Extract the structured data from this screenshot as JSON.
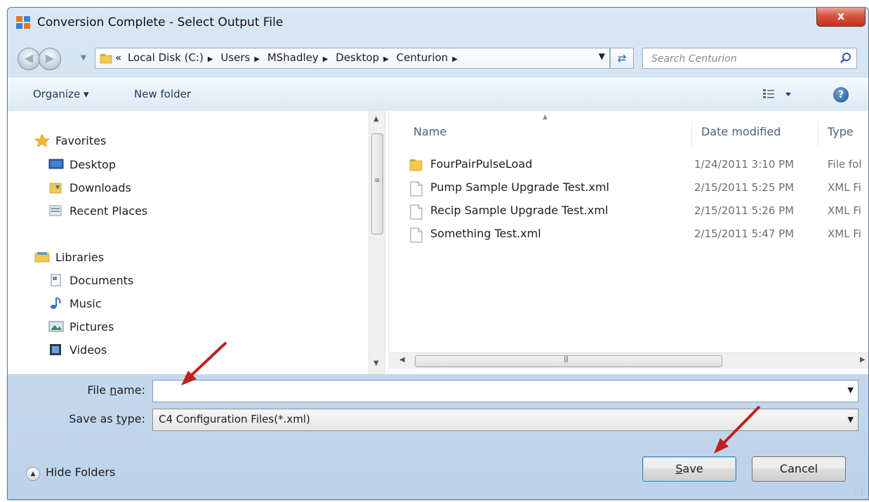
{
  "window": {
    "title": "Conversion Complete - Select Output File",
    "close_label": "x"
  },
  "address": {
    "overflow": "«",
    "path": [
      "Local Disk (C:)",
      "Users",
      "MShadley",
      "Desktop",
      "Centurion"
    ],
    "search_placeholder": "Search Centurion"
  },
  "toolbar": {
    "organize_label": "Organize ▾",
    "new_folder_label": "New folder",
    "help_label": "?"
  },
  "nav": {
    "favorites": {
      "label": "Favorites",
      "items": [
        "Desktop",
        "Downloads",
        "Recent Places"
      ]
    },
    "libraries": {
      "label": "Libraries",
      "items": [
        "Documents",
        "Music",
        "Pictures",
        "Videos"
      ]
    }
  },
  "files": {
    "columns": {
      "name": "Name",
      "date": "Date modified",
      "type": "Type"
    },
    "rows": [
      {
        "name": "FourPairPulseLoad",
        "date": "1/24/2011 3:10 PM",
        "type": "File fol",
        "icon": "folder-icon"
      },
      {
        "name": "Pump Sample Upgrade Test.xml",
        "date": "2/15/2011 5:25 PM",
        "type": "XML Fi",
        "icon": "file-icon"
      },
      {
        "name": "Recip Sample Upgrade Test.xml",
        "date": "2/15/2011 5:26 PM",
        "type": "XML Fi",
        "icon": "file-icon"
      },
      {
        "name": "Something Test.xml",
        "date": "2/15/2011 5:47 PM",
        "type": "XML Fi",
        "icon": "file-icon"
      }
    ]
  },
  "form": {
    "filename_label_pre": "File ",
    "filename_label_ul": "n",
    "filename_label_post": "ame:",
    "filename_value": "",
    "savetype_label_pre": "Save as ",
    "savetype_label_ul": "t",
    "savetype_label_post": "ype:",
    "savetype_value": "C4 Configuration Files(*.xml)"
  },
  "footer": {
    "hide_folders_label": "Hide Folders",
    "save_ul": "S",
    "save_rest": "ave",
    "cancel_label": "Cancel"
  },
  "colors": {
    "annotation_arrow": "#c0201b",
    "accent_blue": "#3c7fb1"
  }
}
